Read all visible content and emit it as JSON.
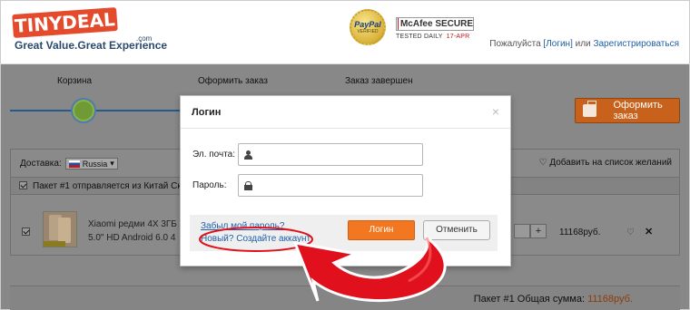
{
  "header": {
    "logo_title": "TINYDEAL",
    "logo_tagline": "Great Value.Great Experience",
    "logo_dotcom": ".com",
    "paypal_text": "PayPal",
    "paypal_verified": "VERIFIED",
    "mcafee_title": "McAfee SECURE",
    "mcafee_tested": "TESTED DAILY",
    "mcafee_date": "17-APR",
    "welcome_prefix": "Пожалуйста ",
    "login_link": "[Логин]",
    "or_text": " или ",
    "register_link": "Зарегистрироваться"
  },
  "steps": [
    "Корзина",
    "Оформить заказ",
    "Заказ завершен"
  ],
  "checkout_button": "Оформить заказ",
  "cart": {
    "delivery_label": "Доставка:",
    "country": "Russia",
    "wishlist": "Добавить на список желаний",
    "package_text": "Пакет #1 отправляется из Китай Скл",
    "item_title_line1": "Xiaomi редми 4X 3ГБ",
    "item_title_line2": "5.0\" HD Android 6.0 4",
    "price": "11168руб.",
    "qty_plus": "+",
    "total_label": "Пакет #1 Общая сумма: ",
    "total_value": "11168руб."
  },
  "modal": {
    "title": "Логин",
    "close": "×",
    "email_label": "Эл. почта:",
    "password_label": "Пароль:",
    "email_value": "",
    "password_value": "",
    "forgot_link": "Забыл мой пароль?",
    "new_prefix": "Новый? ",
    "create_account": "Создайте аккаунт",
    "login_button": "Логин",
    "cancel_button": "Отменить"
  },
  "colors": {
    "accent_orange": "#f27720",
    "link_blue": "#1f5fa8",
    "annotation_red": "#e0101c"
  },
  "icons": [
    "user-icon",
    "lock-icon",
    "close-icon",
    "heart-icon",
    "remove-icon",
    "bag-icon",
    "flag-icon",
    "curved-arrow-annotation"
  ]
}
